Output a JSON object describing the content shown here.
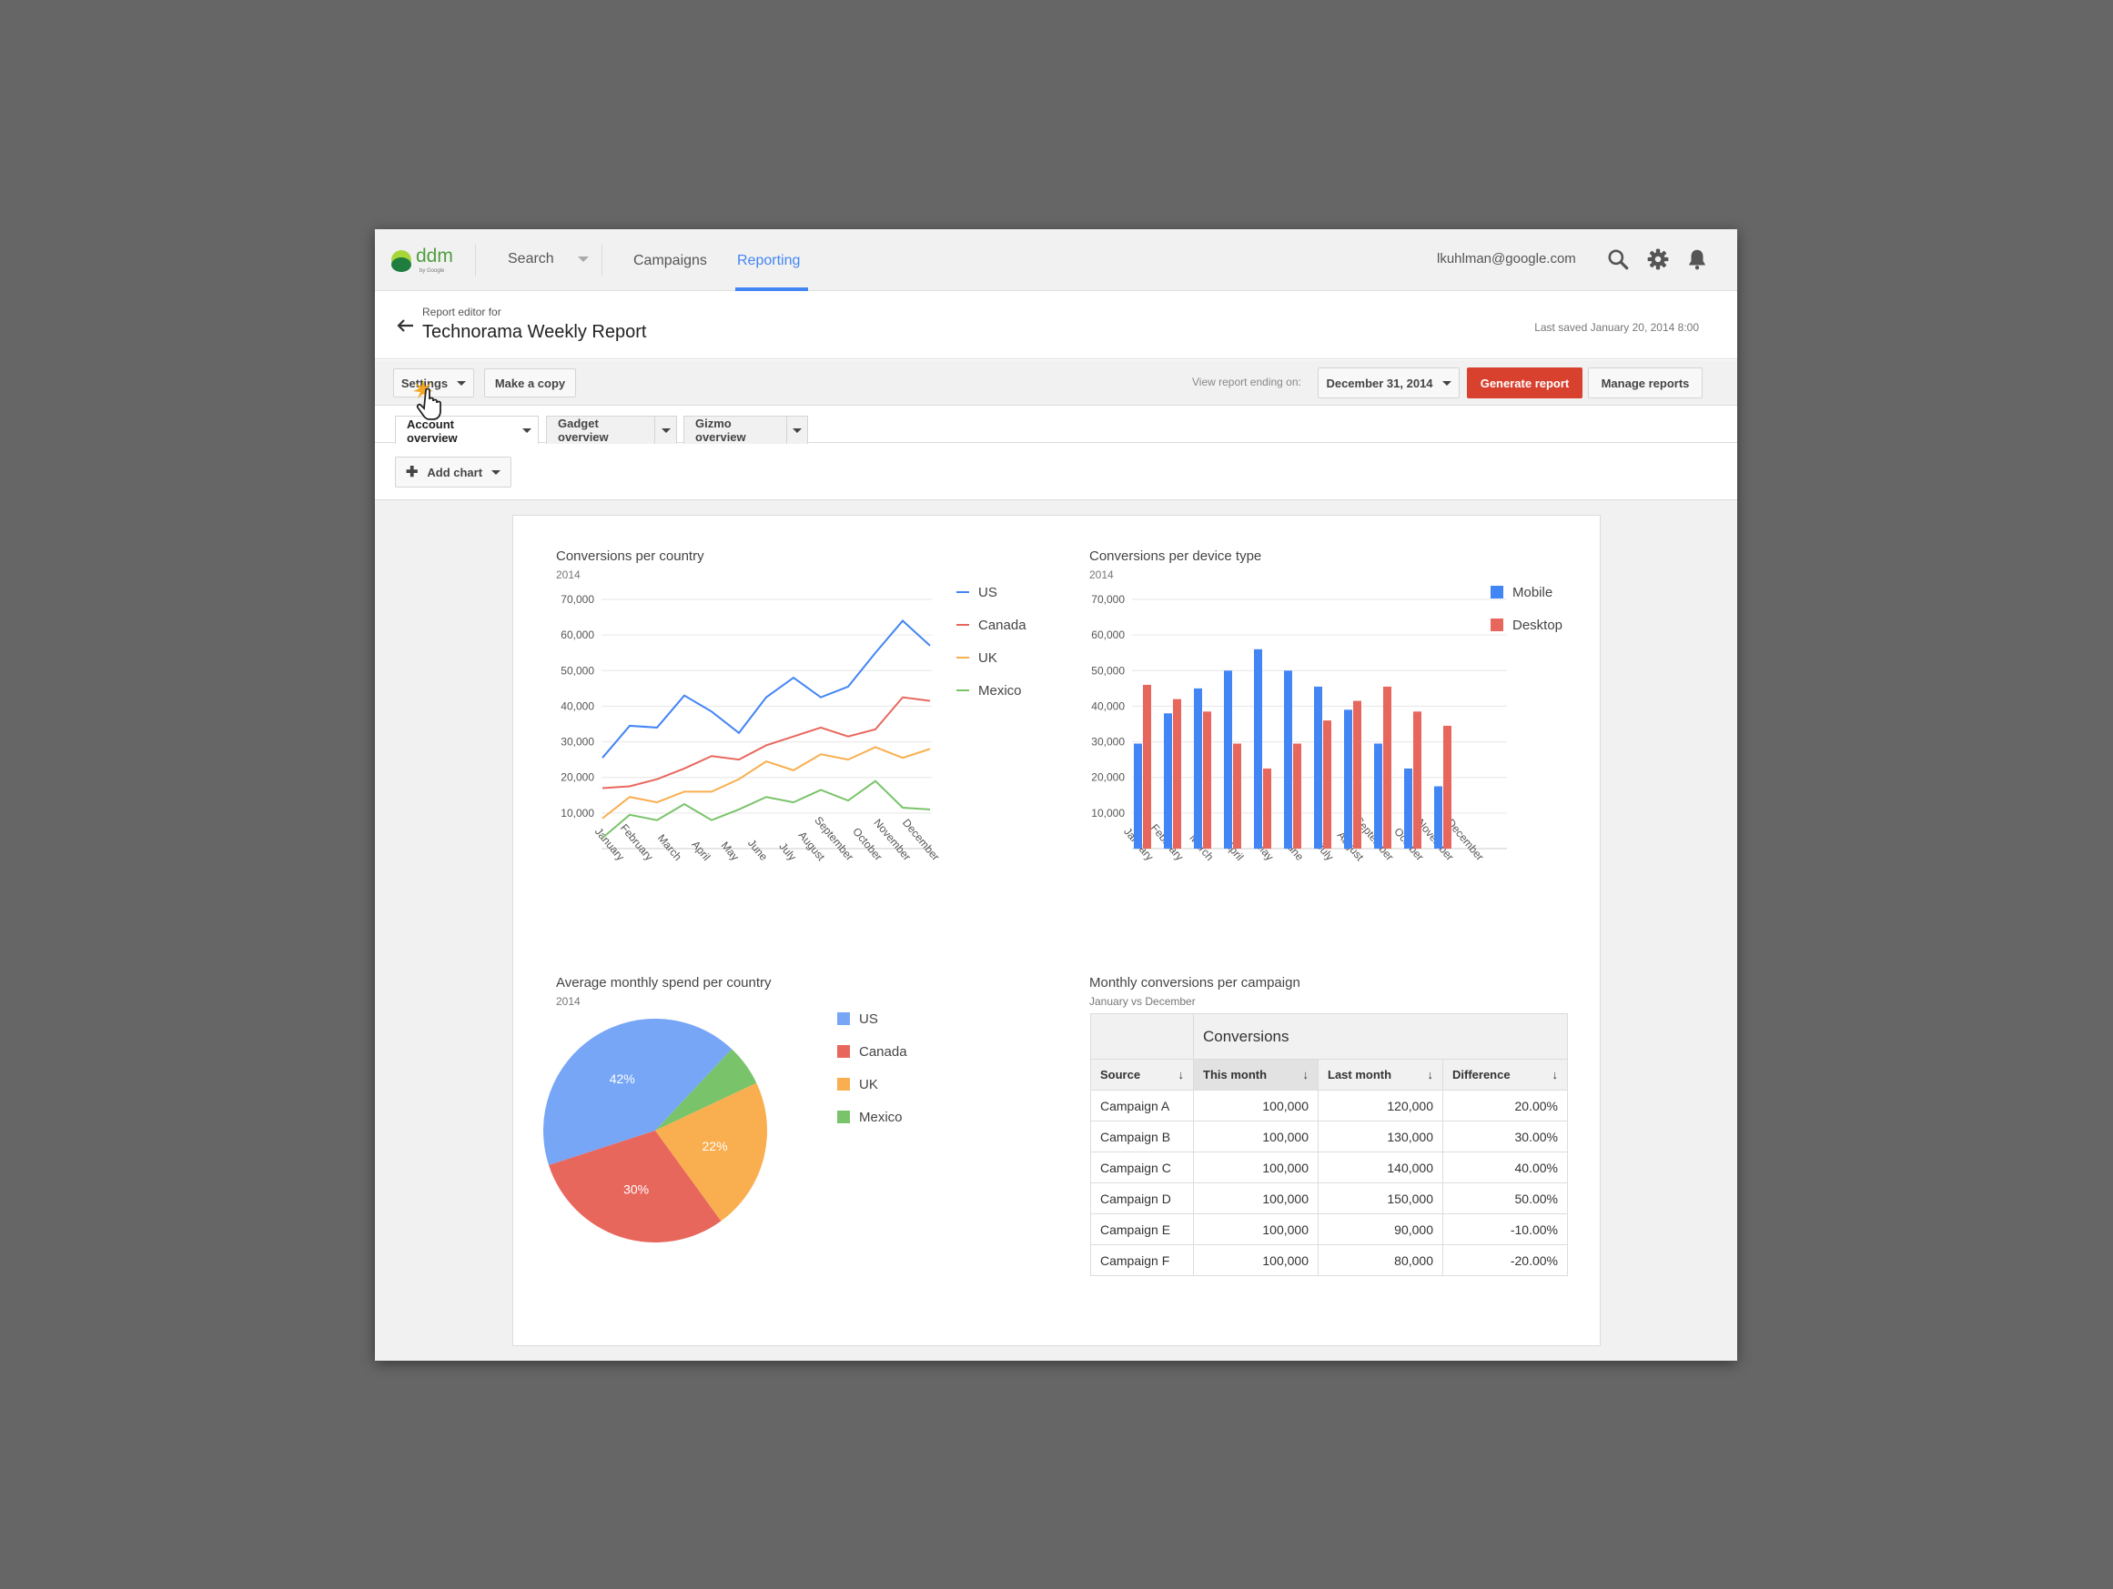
{
  "header": {
    "logo_text": "ddm",
    "logo_sub": "by Google",
    "nav": {
      "search": "Search",
      "campaigns": "Campaigns",
      "reporting": "Reporting"
    },
    "user_email": "lkuhlman@google.com",
    "icons": [
      "search-icon",
      "gear-icon",
      "bell-icon"
    ]
  },
  "title": {
    "subtitle": "Report editor for",
    "report_title": "Technorama Weekly Report",
    "last_saved": "Last saved January 20, 2014 8:00"
  },
  "toolbar": {
    "settings": "Settings",
    "make_copy": "Make a copy",
    "view_ending_label": "View report ending on:",
    "date_value": "December 31, 2014",
    "generate": "Generate report",
    "manage": "Manage reports"
  },
  "tabs": [
    {
      "label": "Account overview",
      "active": true
    },
    {
      "label": "Gadget overview",
      "active": false
    },
    {
      "label": "Gizmo overview",
      "active": false
    }
  ],
  "add_chart": "Add chart",
  "colors": {
    "us": "#4285f4",
    "canada": "#e8675d",
    "uk": "#f9ae4f",
    "mexico": "#79c36a",
    "mobile": "#4285f4",
    "desktop": "#e8675d",
    "generate_button": "#d9412f",
    "accent": "#4285f4"
  },
  "chart_data": [
    {
      "type": "line",
      "title": "Conversions per country",
      "subtitle": "2014",
      "categories": [
        "January",
        "February",
        "March",
        "April",
        "May",
        "June",
        "July",
        "August",
        "September",
        "October",
        "November",
        "December"
      ],
      "ylim": [
        0,
        70000
      ],
      "yticks": [
        "10,000",
        "20,000",
        "30,000",
        "40,000",
        "50,000",
        "60,000",
        "70,000"
      ],
      "legend_position": "right",
      "series": [
        {
          "name": "US",
          "color": "#4285f4",
          "values": [
            25500,
            34500,
            34000,
            43000,
            38500,
            32500,
            42500,
            48000,
            42500,
            45500,
            55000,
            64000,
            57000
          ]
        },
        {
          "name": "Canada",
          "color": "#e8675d",
          "values": [
            17000,
            17500,
            19500,
            22500,
            26000,
            25000,
            29000,
            31500,
            34000,
            31500,
            33500,
            42500,
            41500
          ]
        },
        {
          "name": "UK",
          "color": "#f9ae4f",
          "values": [
            8500,
            14500,
            13000,
            16000,
            16000,
            19500,
            24500,
            22000,
            26500,
            25000,
            28500,
            25500,
            28000
          ]
        },
        {
          "name": "Mexico",
          "color": "#79c36a",
          "values": [
            3000,
            9500,
            8000,
            12500,
            8000,
            11000,
            14500,
            13000,
            16500,
            13500,
            19000,
            11500,
            11000
          ]
        }
      ]
    },
    {
      "type": "bar",
      "title": "Conversions per device type",
      "subtitle": "2014",
      "categories": [
        "January",
        "February",
        "March",
        "April",
        "May",
        "June",
        "July",
        "August",
        "September",
        "October",
        "November",
        "December"
      ],
      "ylim": [
        0,
        70000
      ],
      "yticks": [
        "10,000",
        "20,000",
        "30,000",
        "40,000",
        "50,000",
        "60,000",
        "70,000"
      ],
      "legend_position": "right",
      "series": [
        {
          "name": "Mobile",
          "color": "#4285f4",
          "values": [
            29500,
            38000,
            45000,
            50000,
            56000,
            50000,
            45500,
            39000,
            29500,
            22500,
            17500
          ]
        },
        {
          "name": "Desktop",
          "color": "#e8675d",
          "values": [
            46000,
            42000,
            38500,
            29500,
            22500,
            29500,
            36000,
            41500,
            45500,
            38500,
            34500
          ]
        }
      ]
    },
    {
      "type": "pie",
      "title": "Average monthly spend per country",
      "subtitle": "2014",
      "legend_position": "right",
      "slices": [
        {
          "name": "US",
          "value": 42,
          "label": "42%",
          "color": "#77a6f7"
        },
        {
          "name": "Canada",
          "value": 30,
          "label": "30%",
          "color": "#e8675d"
        },
        {
          "name": "UK",
          "value": 22,
          "label": "22%",
          "color": "#f9ae4f"
        },
        {
          "name": "Mexico",
          "value": 6,
          "label": "",
          "color": "#79c36a"
        }
      ]
    },
    {
      "type": "table",
      "title": "Monthly conversions per campaign",
      "subtitle": "January vs December",
      "group_header": "Conversions",
      "columns": [
        "Source",
        "This month",
        "Last month",
        "Difference"
      ],
      "rows": [
        [
          "Campaign A",
          "100,000",
          "120,000",
          "20.00%"
        ],
        [
          "Campaign B",
          "100,000",
          "130,000",
          "30.00%"
        ],
        [
          "Campaign C",
          "100,000",
          "140,000",
          "40.00%"
        ],
        [
          "Campaign D",
          "100,000",
          "150,000",
          "50.00%"
        ],
        [
          "Campaign E",
          "100,000",
          "90,000",
          "-10.00%"
        ],
        [
          "Campaign F",
          "100,000",
          "80,000",
          "-20.00%"
        ]
      ]
    }
  ]
}
